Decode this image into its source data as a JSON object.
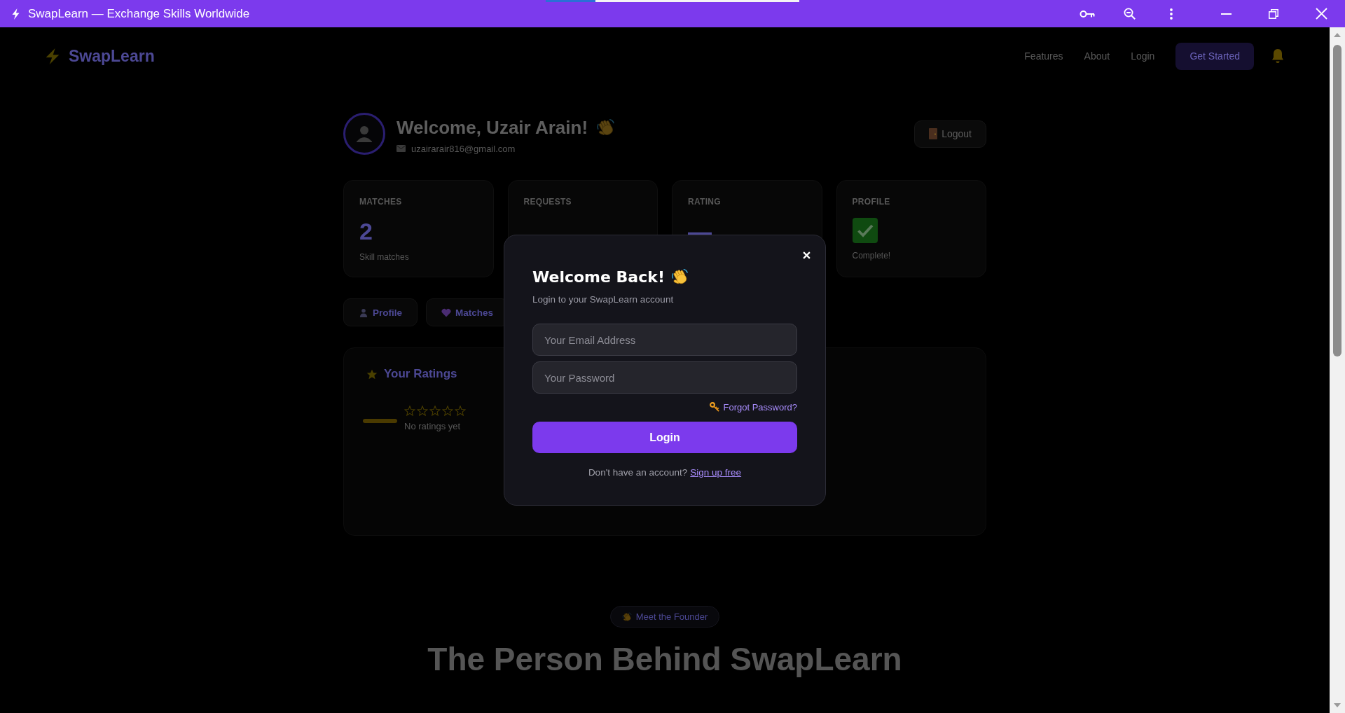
{
  "window": {
    "title": "SwapLearn — Exchange Skills Worldwide"
  },
  "navbar": {
    "brand": "SwapLearn",
    "links": [
      "Features",
      "About",
      "Login"
    ],
    "cta": "Get Started"
  },
  "dashboard": {
    "welcome": "Welcome, Uzair Arain!",
    "email": "uzairarair816@gmail.com",
    "logout": "Logout",
    "stats": [
      {
        "kind": "number",
        "label": "MATCHES",
        "value": "2",
        "note": "Skill matches"
      },
      {
        "kind": "number",
        "label": "REQUESTS"
      },
      {
        "kind": "number",
        "label": "RATING",
        "value": "—"
      },
      {
        "kind": "check",
        "label": "PROFILE",
        "note": "Complete!"
      }
    ],
    "tabs": [
      {
        "label": "Profile"
      },
      {
        "label": "Matches"
      }
    ],
    "ratings": {
      "title": "Your Ratings",
      "stars": 0,
      "empty_text": "No ratings yet"
    }
  },
  "founder": {
    "badge": "Meet the Founder",
    "heading": "The Person Behind SwapLearn"
  },
  "modal": {
    "title": "Welcome Back!",
    "subtitle": "Login to your SwapLearn account",
    "fields": [
      {
        "placeholder": "Your Email Address"
      },
      {
        "placeholder": "Your Password"
      }
    ],
    "forgot_link": "Forgot Password?",
    "submit": "Login",
    "footer_text": "Don't have an account?",
    "footer_link": "Sign up free"
  }
}
